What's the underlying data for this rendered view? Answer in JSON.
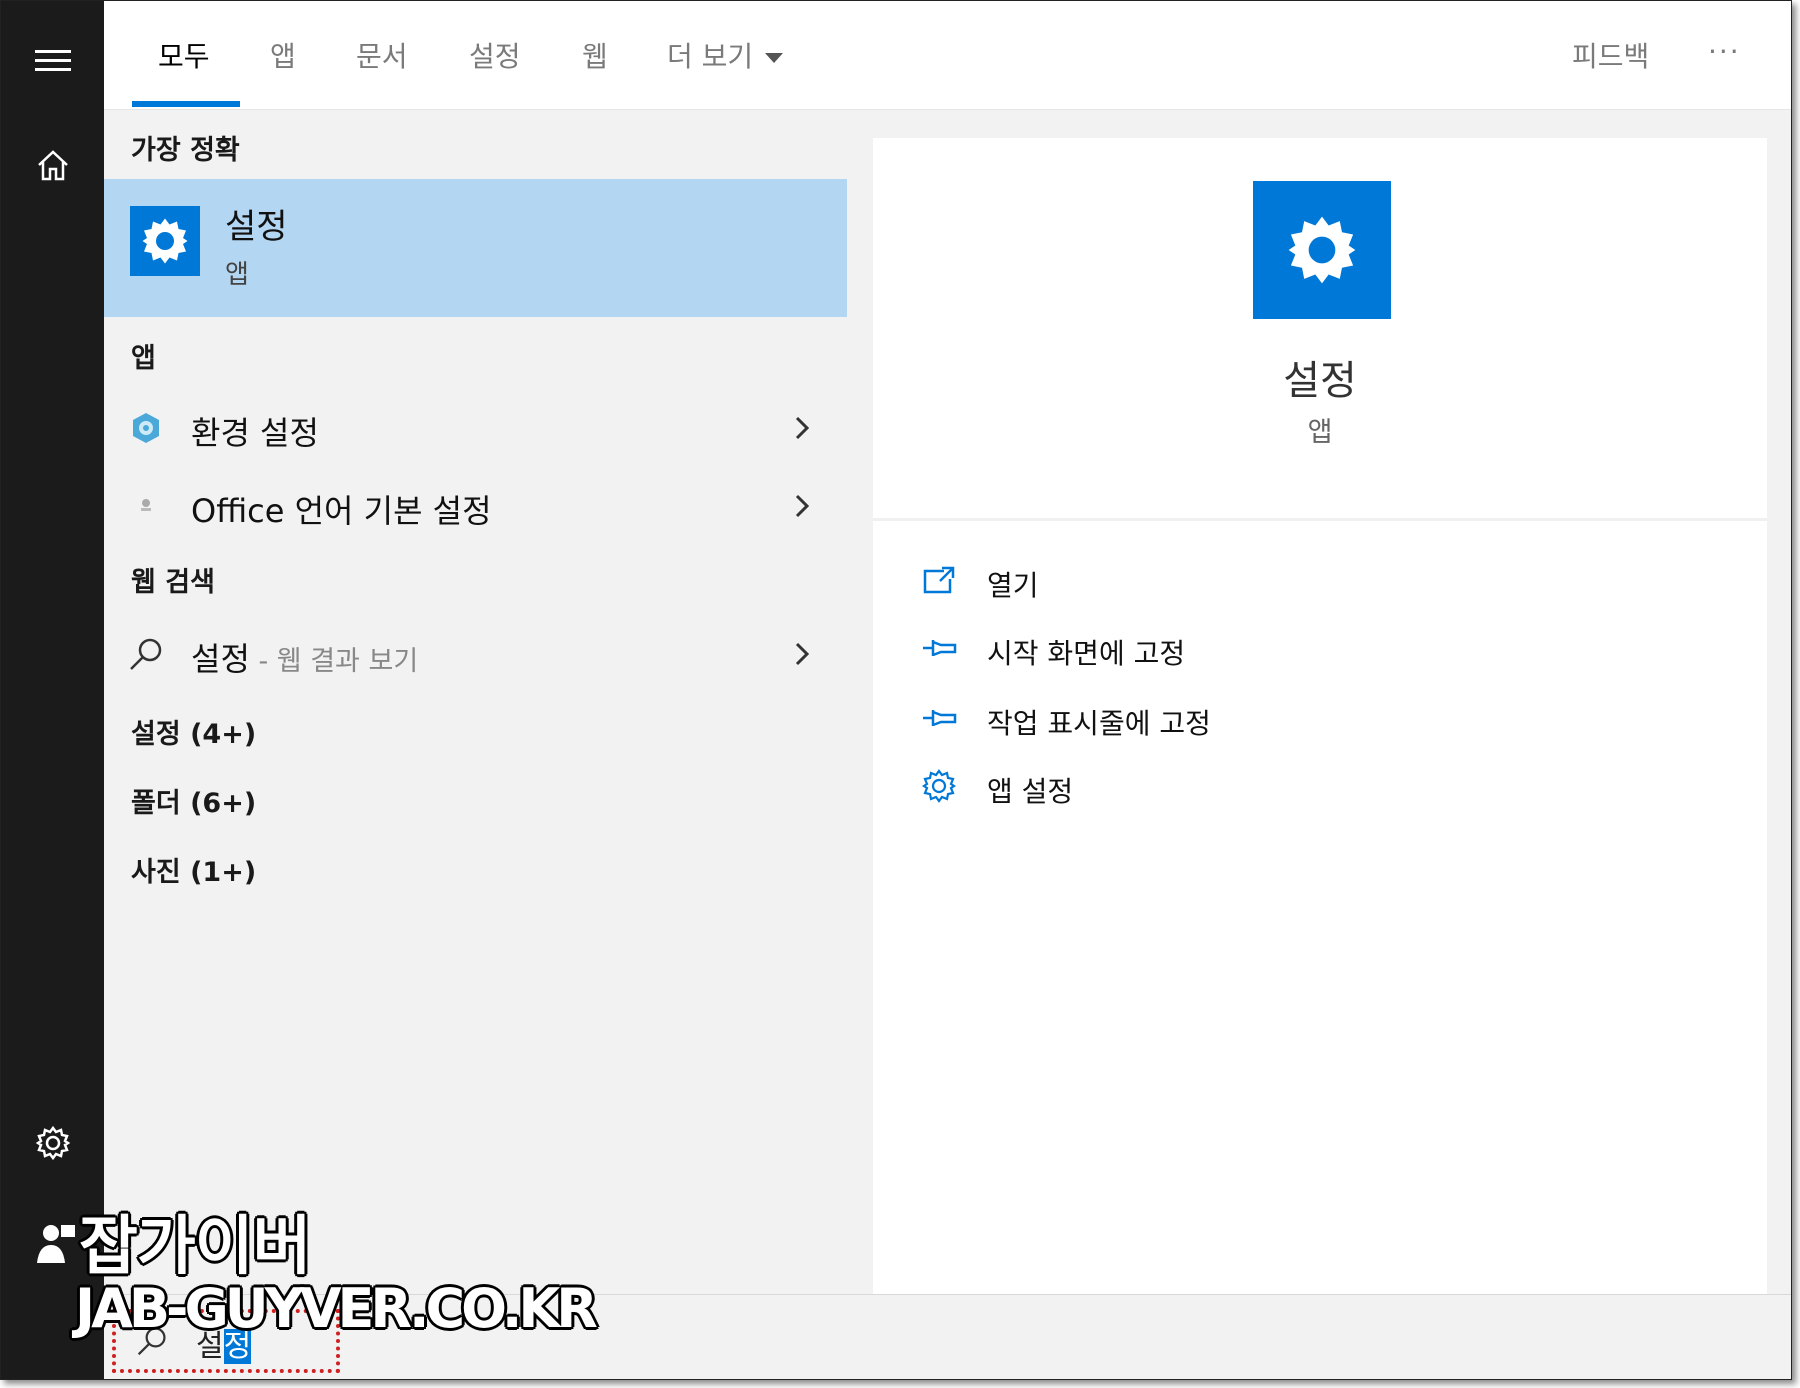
{
  "tabs": {
    "all": "모두",
    "apps": "앱",
    "documents": "문서",
    "settings": "설정",
    "web": "웹",
    "more": "더 보기",
    "feedback": "피드백",
    "overflow": "···"
  },
  "left": {
    "best_match_header": "가장 정확",
    "best_match": {
      "title": "설정",
      "subtitle": "앱"
    },
    "apps_header": "앱",
    "apps": [
      {
        "label": "환경 설정",
        "icon": "control-panel-icon"
      },
      {
        "label": "Office 언어 기본 설정",
        "icon": "office-language-icon"
      }
    ],
    "web_header": "웹 검색",
    "web": {
      "label": "설정",
      "hint": " - 웹 결과 보기",
      "icon": "search-icon"
    },
    "groups": [
      "설정 (4+)",
      "폴더 (6+)",
      "사진 (1+)"
    ]
  },
  "detail": {
    "title": "설정",
    "subtitle": "앱",
    "actions": [
      {
        "label": "열기",
        "icon": "open-icon"
      },
      {
        "label": "시작 화면에 고정",
        "icon": "pin-icon"
      },
      {
        "label": "작업 표시줄에 고정",
        "icon": "pin-icon"
      },
      {
        "label": "앱 설정",
        "icon": "gear-icon"
      }
    ]
  },
  "search": {
    "query_prefix": "설",
    "query_selected": "정"
  },
  "watermark": {
    "line1": "잡가이버",
    "line2": "JAB-GUYVER.CO.KR"
  },
  "colors": {
    "accent": "#0078d7",
    "selection": "#b3d7f2",
    "rail": "#1b1b1b",
    "pane": "#f2f2f2"
  }
}
